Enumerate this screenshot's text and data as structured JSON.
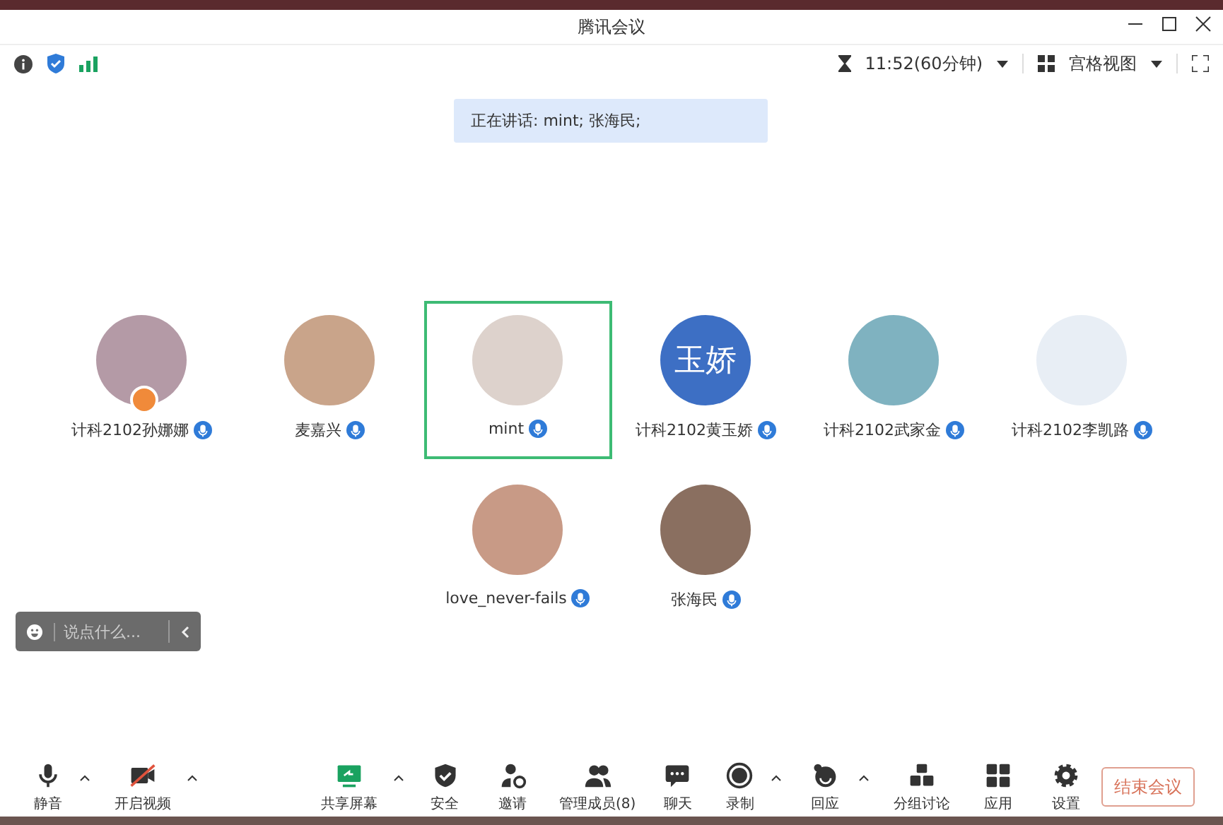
{
  "window": {
    "title": "腾讯会议"
  },
  "info_bar": {
    "time": "11:52(60分钟)",
    "view": "宫格视图"
  },
  "speaking_banner": "正在讲话: mint; 张海民;",
  "participants": [
    {
      "name": "计科2102孙娜娜",
      "kind": "photo",
      "color": "#b49aa6",
      "host": true,
      "selected": false
    },
    {
      "name": "麦嘉兴",
      "kind": "photo",
      "color": "#c9a48a",
      "host": false,
      "selected": false
    },
    {
      "name": "mint",
      "kind": "photo",
      "color": "#ddd2cc",
      "host": false,
      "selected": true
    },
    {
      "name": "计科2102黄玉娇",
      "kind": "text",
      "avatar_text": "玉娇",
      "color": "#3d6fc4",
      "host": false,
      "selected": false
    },
    {
      "name": "计科2102武家金",
      "kind": "photo",
      "color": "#7fb2c0",
      "host": false,
      "selected": false
    },
    {
      "name": "计科2102李凯路",
      "kind": "photo",
      "color": "#e8eef5",
      "host": false,
      "selected": false
    },
    {
      "name": "love_never-fails",
      "kind": "photo",
      "color": "#c89a86",
      "host": false,
      "selected": false
    },
    {
      "name": "张海民",
      "kind": "photo",
      "color": "#8a6f60",
      "host": false,
      "selected": false
    }
  ],
  "chat_input": {
    "placeholder": "说点什么..."
  },
  "toolbar": [
    {
      "label": "静音",
      "caret": true
    },
    {
      "label": "开启视频",
      "caret": true
    },
    {
      "label": "共享屏幕",
      "caret": true
    },
    {
      "label": "安全",
      "caret": false
    },
    {
      "label": "邀请",
      "caret": false
    },
    {
      "label": "管理成员(8)",
      "caret": false
    },
    {
      "label": "聊天",
      "caret": false
    },
    {
      "label": "录制",
      "caret": true
    },
    {
      "label": "回应",
      "caret": true
    },
    {
      "label": "分组讨论",
      "caret": false
    },
    {
      "label": "应用",
      "caret": false
    },
    {
      "label": "设置",
      "caret": false
    }
  ],
  "end_button": "结束会议"
}
